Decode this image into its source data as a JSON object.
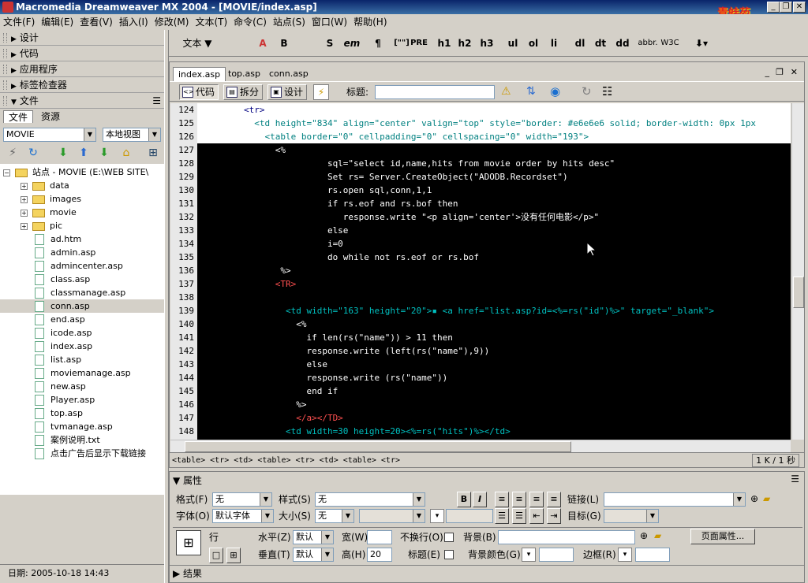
{
  "window": {
    "title": "Macromedia Dreamweaver MX 2004 - [MOVIE/index.asp]",
    "logo_text": "青蛙苑"
  },
  "menu": [
    "文件(F)",
    "编辑(E)",
    "查看(V)",
    "插入(I)",
    "修改(M)",
    "文本(T)",
    "命令(C)",
    "站点(S)",
    "窗口(W)",
    "帮助(H)"
  ],
  "panels": {
    "groups": [
      "设计",
      "代码",
      "应用程序",
      "标签检查器",
      "文件"
    ]
  },
  "files_panel": {
    "tabs": [
      "文件",
      "资源"
    ],
    "site_select": "MOVIE",
    "view_select": "本地视图",
    "site_root": "站点 - MOVIE (E:\\WEB SITE\\",
    "folders": [
      "data",
      "images",
      "movie",
      "pic"
    ],
    "files": [
      "ad.htm",
      "admin.asp",
      "admincenter.asp",
      "class.asp",
      "classmanage.asp",
      "conn.asp",
      "end.asp",
      "icode.asp",
      "index.asp",
      "list.asp",
      "moviemanage.asp",
      "new.asp",
      "Player.asp",
      "top.asp",
      "tvmanage.asp",
      "案例说明.txt",
      "点击广告后显示下载链接"
    ],
    "selected_file": "conn.asp",
    "date": "日期: 2005-10-18 14:43"
  },
  "insert_toolbar": {
    "category": "文本",
    "buttons": [
      "B",
      "S",
      "em",
      "¶",
      "[\"\"]",
      "PRE",
      "h1",
      "h2",
      "h3",
      "ul",
      "ol",
      "li",
      "dl",
      "dt",
      "dd",
      "abbr.",
      "W3C"
    ]
  },
  "document": {
    "tabs": [
      "index.asp",
      "top.asp",
      "conn.asp"
    ],
    "views": [
      "代码",
      "拆分",
      "设计"
    ],
    "title_label": "标题:",
    "title_value": "",
    "code_lines": [
      {
        "n": "124",
        "t": "        <tr>",
        "c": "#000080"
      },
      {
        "n": "125",
        "t": "          <td height=\"834\" align=\"center\" valign=\"top\" style=\"border: #e6e6e6 solid; border-width: 0px 1px",
        "c": "#008080"
      },
      {
        "n": "126",
        "t": "            <table border=\"0\" cellpadding=\"0\" cellspacing=\"0\" width=\"193\">",
        "c": "#008080"
      },
      {
        "n": "127",
        "t": "              <%",
        "c": "#ffffff"
      },
      {
        "n": "128",
        "t": "                        sql=\"select id,name,hits from movie order by hits desc\"",
        "c": "#ffffff"
      },
      {
        "n": "129",
        "t": "                        Set rs= Server.CreateObject(\"ADODB.Recordset\")",
        "c": "#ffffff"
      },
      {
        "n": "130",
        "t": "                        rs.open sql,conn,1,1",
        "c": "#ffffff"
      },
      {
        "n": "131",
        "t": "                        if rs.eof and rs.bof then",
        "c": "#ffffff"
      },
      {
        "n": "132",
        "t": "                           response.write \"<p align='center'>没有任何电影</p>\"",
        "c": "#ffffff"
      },
      {
        "n": "133",
        "t": "                        else",
        "c": "#ffffff"
      },
      {
        "n": "134",
        "t": "                        i=0",
        "c": "#ffffff"
      },
      {
        "n": "135",
        "t": "                        do while not rs.eof or rs.bof",
        "c": "#ffffff"
      },
      {
        "n": "136",
        "t": "               %>",
        "c": "#ffffff"
      },
      {
        "n": "137",
        "t": "              <TR>",
        "c": "#ff5050"
      },
      {
        "n": "138",
        "t": "",
        "c": "#ffffff"
      },
      {
        "n": "139",
        "t": "                <td width=\"163\" height=\"20\">▪ <a href=\"list.asp?id=<%=rs(\"id\")%>\" target=\"_blank\">",
        "c": "#00c0c0"
      },
      {
        "n": "140",
        "t": "                  <%",
        "c": "#ffffff"
      },
      {
        "n": "141",
        "t": "                    if len(rs(\"name\")) > 11 then",
        "c": "#ffffff"
      },
      {
        "n": "142",
        "t": "                    response.write (left(rs(\"name\"),9))",
        "c": "#ffffff"
      },
      {
        "n": "143",
        "t": "                    else",
        "c": "#ffffff"
      },
      {
        "n": "144",
        "t": "                    response.write (rs(\"name\"))",
        "c": "#ffffff"
      },
      {
        "n": "145",
        "t": "                    end if",
        "c": "#ffffff"
      },
      {
        "n": "146",
        "t": "                  %>",
        "c": "#ffffff"
      },
      {
        "n": "147",
        "t": "                  </a></TD>",
        "c": "#ff5050"
      },
      {
        "n": "148",
        "t": "                <td width=30 height=20><%=rs(\"hits\")%></td>",
        "c": "#00c0c0"
      }
    ],
    "tag_path": "<table> <tr> <td> <table> <tr> <td> <table> <tr>",
    "status_right": "1 K / 1 秒"
  },
  "properties": {
    "title": "属性",
    "format_label": "格式(F)",
    "format_value": "无",
    "style_label": "样式(S)",
    "style_value": "无",
    "font_label": "字体(O)",
    "font_value": "默认字体",
    "size_label": "大小(S)",
    "size_value": "无",
    "link_label": "链接(L)",
    "target_label": "目标(G)",
    "row_label": "行",
    "horiz_label": "水平(Z)",
    "horiz_value": "默认",
    "vert_label": "垂直(T)",
    "vert_value": "默认",
    "width_label": "宽(W)",
    "width_value": "",
    "height_label": "高(H)",
    "height_value": "20",
    "nowrap_label": "不换行(O)",
    "header_label": "标题(E)",
    "bg_label": "背景(B)",
    "bgcolor_label": "背景颜色(G)",
    "border_label": "边框(R)",
    "page_props_button": "页面属性...",
    "results_title": "结果"
  }
}
